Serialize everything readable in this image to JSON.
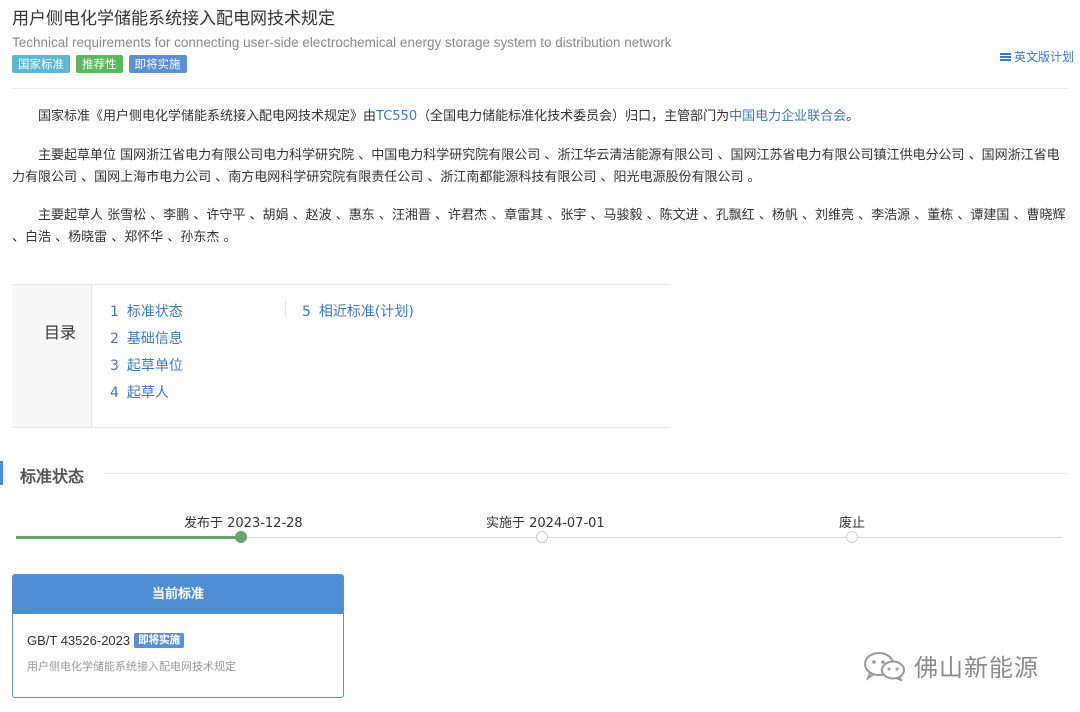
{
  "header": {
    "title_cn": "用户侧电化学储能系统接入配电网技术规定",
    "title_en": "Technical requirements for connecting user-side electrochemical energy storage system to distribution network",
    "badges": [
      "国家标准",
      "推荐性",
      "即将实施"
    ],
    "en_plan_link": "英文版计划"
  },
  "intro": {
    "p1_prefix": "国家标准《用户侧电化学储能系统接入配电网技术规定》由",
    "p1_tc": "TC550",
    "p1_mid": "（全国电力储能标准化技术委员会）归口，主管部门为",
    "p1_dept": "中国电力企业联合会",
    "p1_suffix": "。",
    "p2": "主要起草单位 国网浙江省电力有限公司电力科学研究院 、中国电力科学研究院有限公司 、浙江华云清洁能源有限公司 、国网江苏省电力有限公司镇江供电分公司 、国网浙江省电力有限公司 、国网上海市电力公司 、南方电网科学研究院有限责任公司 、浙江南都能源科技有限公司 、阳光电源股份有限公司 。",
    "p3": "主要起草人 张雪松 、李鹏 、许守平 、胡娟 、赵波 、惠东 、汪湘晋 、许君杰 、章雷其 、张宇 、马骏毅 、陈文进 、孔飘红 、杨帆 、刘维亮 、李浩源 、董栋 、谭建国 、曹晓辉 、白浩 、杨晓雷 、郑怀华 、孙东杰 。"
  },
  "toc": {
    "label": "目录",
    "items": [
      {
        "num": "1",
        "label": "标准状态"
      },
      {
        "num": "2",
        "label": "基础信息"
      },
      {
        "num": "3",
        "label": "起草单位"
      },
      {
        "num": "4",
        "label": "起草人"
      },
      {
        "num": "5",
        "label": "相近标准(计划)"
      }
    ]
  },
  "status": {
    "section_title": "标准状态",
    "timeline": [
      {
        "label": "发布于 2023-12-28",
        "active": true
      },
      {
        "label": "实施于 2024-07-01",
        "active": false
      },
      {
        "label": "废止",
        "active": false
      }
    ]
  },
  "card": {
    "header": "当前标准",
    "code": "GB/T 43526-2023",
    "badge": "即将实施",
    "name": "用户侧电化学储能系统接入配电网技术规定"
  },
  "watermark": {
    "text": "佛山新能源",
    "icon": "wechat-icon"
  },
  "colors": {
    "link": "#3a7bc8",
    "accent": "#4f8ed3",
    "progress": "#6aa66a"
  }
}
